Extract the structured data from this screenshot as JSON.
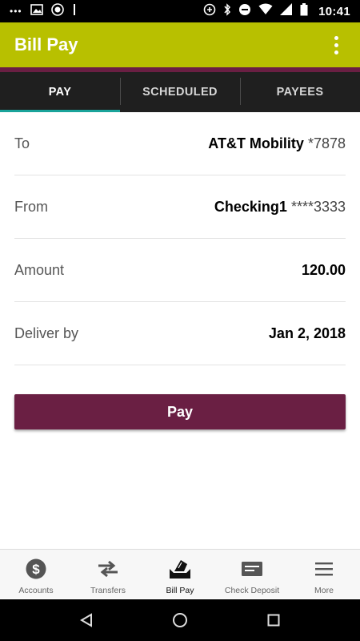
{
  "status_bar": {
    "time": "10:41",
    "left_dots": "•••"
  },
  "app_bar": {
    "title": "Bill Pay"
  },
  "tabs": [
    {
      "label": "PAY",
      "active": true
    },
    {
      "label": "SCHEDULED",
      "active": false
    },
    {
      "label": "PAYEES",
      "active": false
    }
  ],
  "form": {
    "to": {
      "label": "To",
      "value": "AT&T Mobility",
      "suffix": "*7878"
    },
    "from": {
      "label": "From",
      "value": "Checking1",
      "suffix": "****3333"
    },
    "amount": {
      "label": "Amount",
      "value": "120.00"
    },
    "deliver_by": {
      "label": "Deliver by",
      "value": "Jan 2, 2018"
    }
  },
  "pay_button": {
    "label": "Pay"
  },
  "bottom_nav": [
    {
      "label": "Accounts",
      "icon": "dollar-circle-icon"
    },
    {
      "label": "Transfers",
      "icon": "transfer-arrows-icon"
    },
    {
      "label": "Bill Pay",
      "icon": "bill-pay-icon",
      "active": true
    },
    {
      "label": "Check Deposit",
      "icon": "check-deposit-icon"
    },
    {
      "label": "More",
      "icon": "menu-icon"
    }
  ],
  "colors": {
    "app_bar": "#b8c000",
    "accent": "#6a1f43",
    "tab_indicator": "#1aa39a",
    "tab_background": "#1f1f1f"
  }
}
